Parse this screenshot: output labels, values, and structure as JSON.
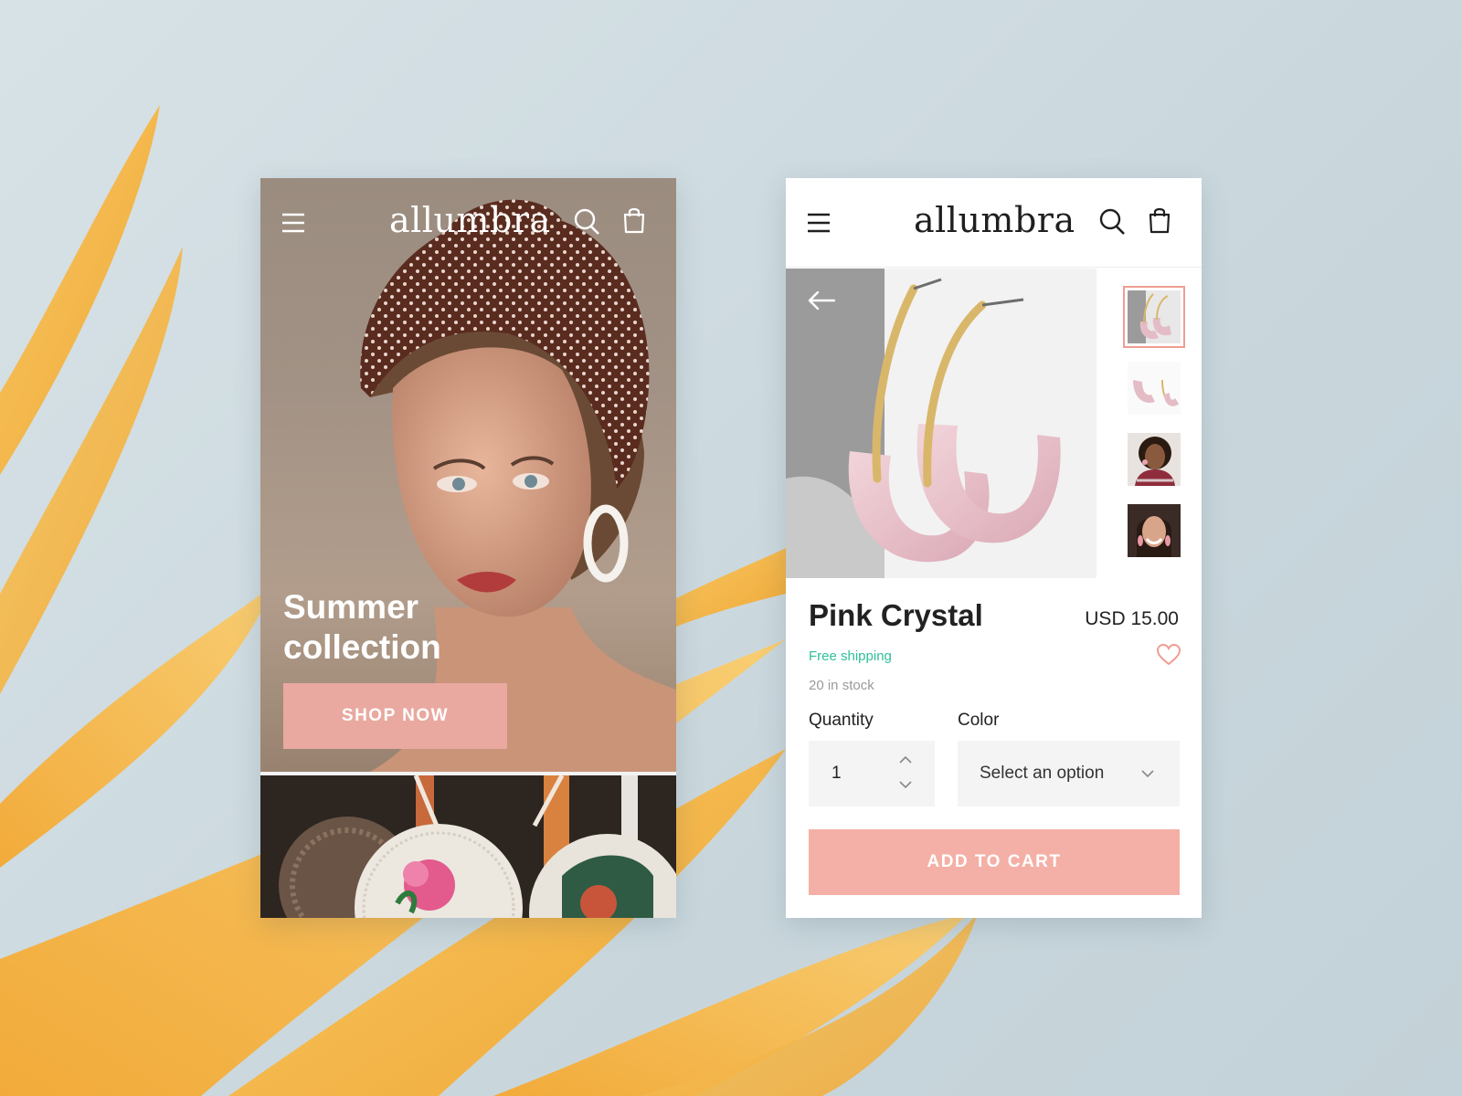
{
  "brand": "allumbra",
  "colors": {
    "accent": "#e9a9a0",
    "cart_button": "#f4b0a6",
    "free_shipping": "#2fbf9a",
    "leaf": "#f5b94a",
    "background": "#cfdce1"
  },
  "home": {
    "hero_title_line1": "Summer",
    "hero_title_line2": "collection",
    "cta_label": "SHOP NOW",
    "icons": [
      "menu-icon",
      "search-icon",
      "shopping-bag-icon"
    ]
  },
  "product": {
    "name": "Pink Crystal",
    "price": "USD 15.00",
    "shipping": "Free shipping",
    "stock": "20 in stock",
    "quantity_label": "Quantity",
    "quantity_value": "1",
    "color_label": "Color",
    "color_placeholder": "Select an option",
    "cart_label": "ADD TO CART",
    "thumbnail_count": 4,
    "icons": [
      "menu-icon",
      "search-icon",
      "shopping-bag-icon",
      "back-arrow-icon",
      "heart-icon",
      "chevron-up-icon",
      "chevron-down-icon"
    ]
  }
}
